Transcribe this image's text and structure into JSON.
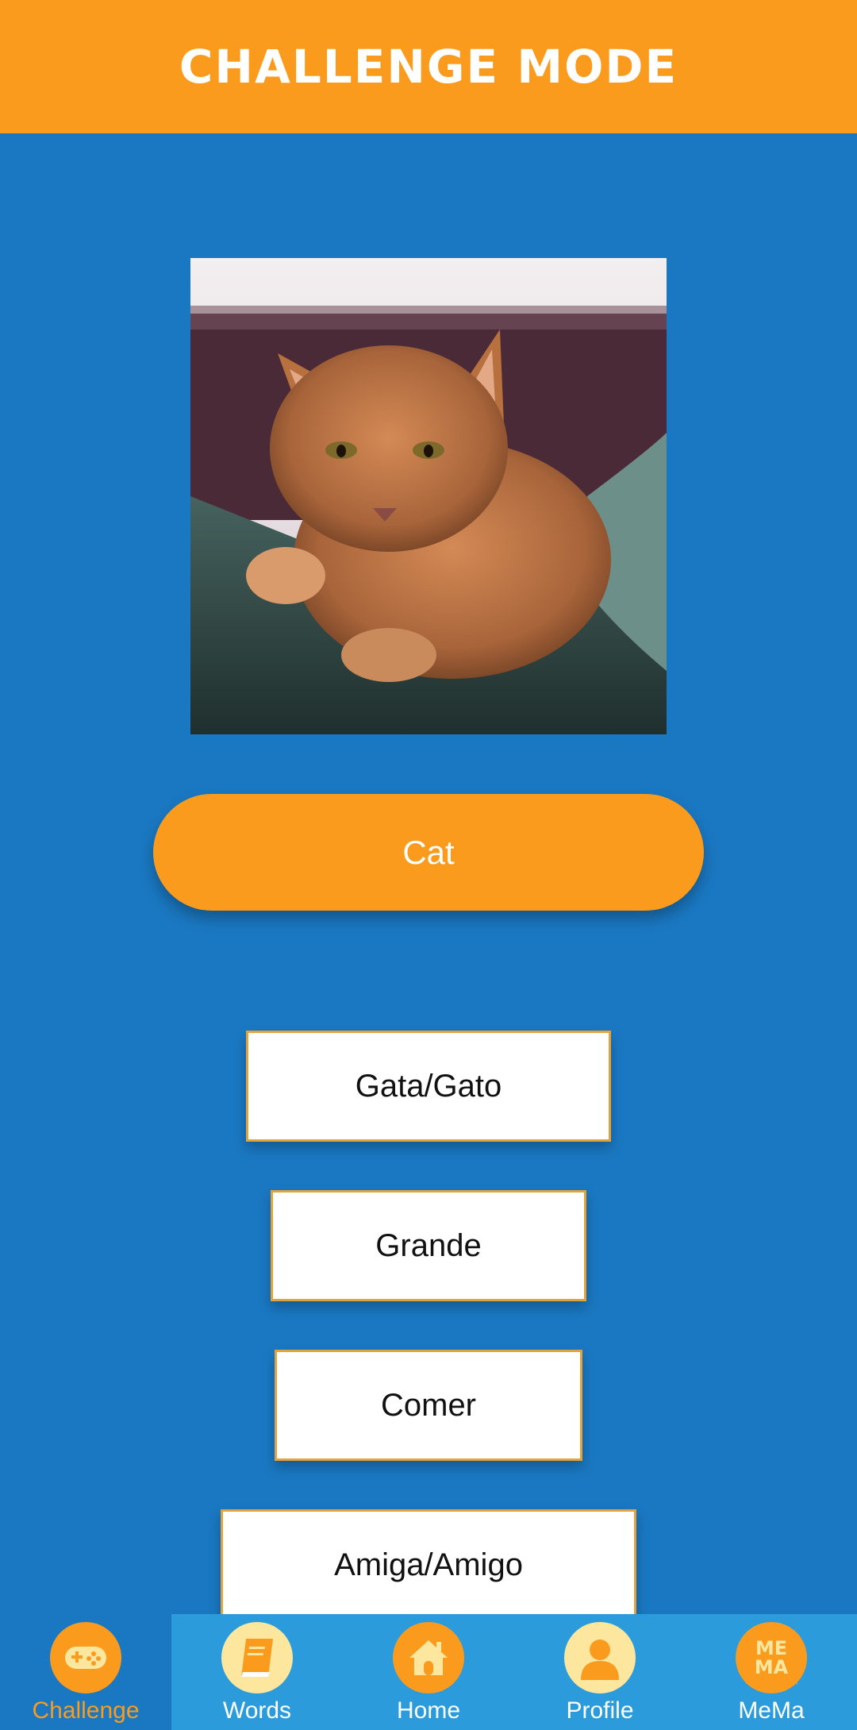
{
  "header": {
    "title": "CHALLENGE MODE"
  },
  "prompt": {
    "word": "Cat"
  },
  "options": [
    {
      "label": "Gata/Gato"
    },
    {
      "label": "Grande"
    },
    {
      "label": "Comer"
    },
    {
      "label": "Amiga/Amigo"
    }
  ],
  "nav": [
    {
      "label": "Challenge",
      "icon": "gamepad-icon",
      "active": true
    },
    {
      "label": "Words",
      "icon": "book-icon",
      "active": false
    },
    {
      "label": "Home",
      "icon": "house-icon",
      "active": false
    },
    {
      "label": "Profile",
      "icon": "person-icon",
      "active": false
    },
    {
      "label": "MeMa",
      "icon": "mema-logo-icon",
      "active": false
    }
  ],
  "colors": {
    "background": "#1a78c2",
    "accent": "#fb9b1d",
    "navbar": "#2b9bdb",
    "option_border": "#e2a23c"
  }
}
